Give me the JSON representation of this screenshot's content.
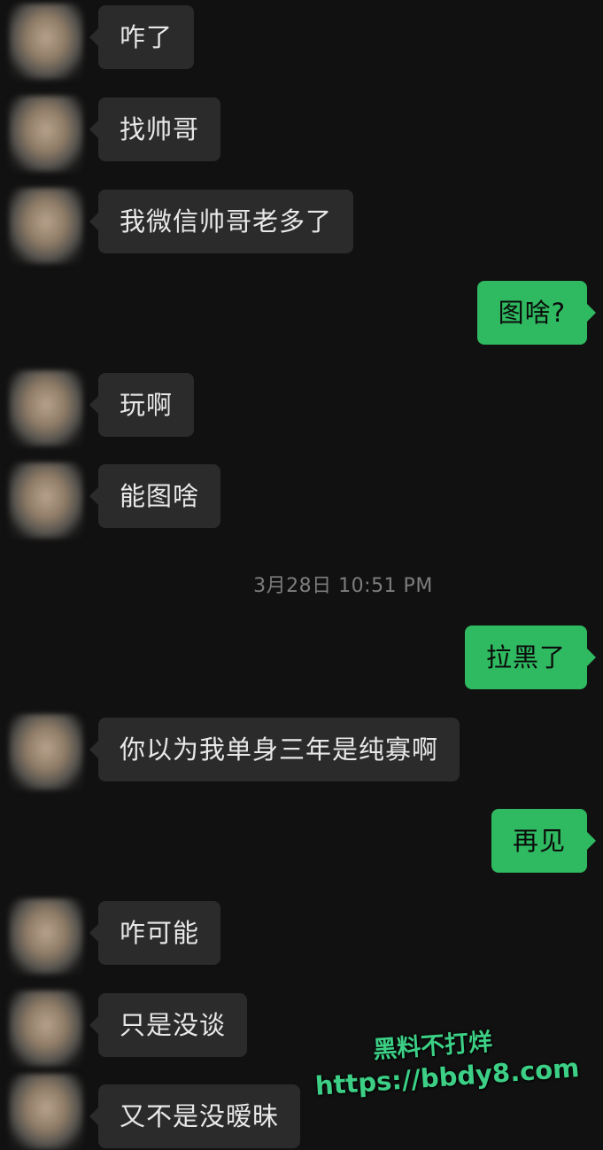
{
  "messages": [
    {
      "side": "in",
      "text": "咋了"
    },
    {
      "side": "in",
      "text": "找帅哥"
    },
    {
      "side": "in",
      "text": "我微信帅哥老多了"
    },
    {
      "side": "out",
      "text": "图啥?"
    },
    {
      "side": "in",
      "text": "玩啊"
    },
    {
      "side": "in",
      "text": "能图啥"
    },
    {
      "side": "out",
      "text": "拉黑了"
    },
    {
      "side": "in",
      "text": "你以为我单身三年是纯寡啊"
    },
    {
      "side": "out",
      "text": "再见"
    },
    {
      "side": "in",
      "text": "咋可能"
    },
    {
      "side": "in",
      "text": "只是没谈"
    },
    {
      "side": "in",
      "text": "又不是没暧昧"
    }
  ],
  "timestamp": "3月28日 10:51 PM",
  "watermark": {
    "line1": "黑料不打烊",
    "line2": "https://bbdy8.com"
  },
  "colors": {
    "background": "#111111",
    "incoming_bubble": "#2b2b2b",
    "outgoing_bubble": "#2fb960",
    "watermark": "#3ccf85"
  }
}
